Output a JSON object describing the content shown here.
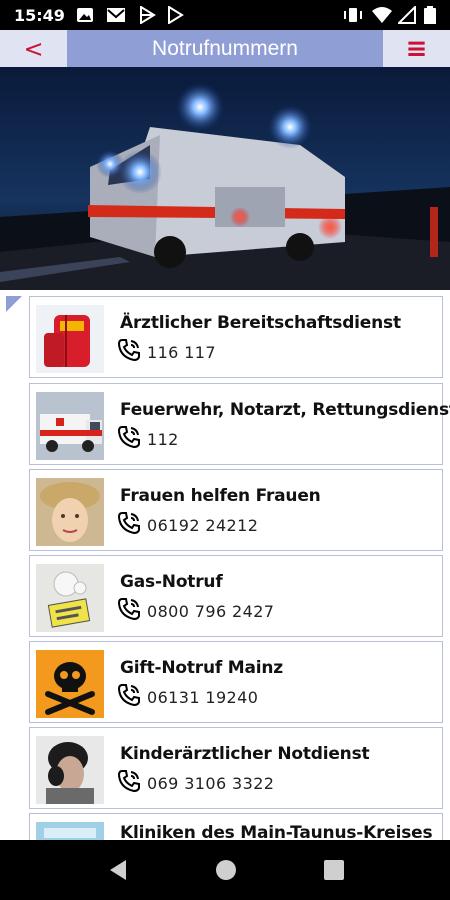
{
  "status_bar": {
    "time": "15:49"
  },
  "header": {
    "back_label": "<",
    "title": "Notrufnummern",
    "menu_label": "≡"
  },
  "entries": [
    {
      "name": "Ärztlicher Bereitschaftsdienst",
      "number": "116 117",
      "thumb": "first-aid-bag-icon"
    },
    {
      "name": "Feuerwehr, Notarzt, Rettungsdienst",
      "number": "112",
      "thumb": "ambulance-icon"
    },
    {
      "name": "Frauen helfen Frauen",
      "number": "06192 24212",
      "thumb": "woman-portrait"
    },
    {
      "name": "Gas-Notruf",
      "number": "0800 796 2427",
      "thumb": "gas-meter"
    },
    {
      "name": "Gift-Notruf Mainz",
      "number": "06131 19240",
      "thumb": "skull-crossbones-icon"
    },
    {
      "name": "Kinderärztlicher Notdienst",
      "number": "069 3106 3322",
      "thumb": "child-portrait"
    },
    {
      "name": "Kliniken des Main-Taunus-Kreises",
      "number": "",
      "thumb": "clinic"
    }
  ],
  "colors": {
    "header_bg": "#8f9fd6",
    "header_button_bg": "#dfe3f2",
    "accent": "#cc1133"
  }
}
